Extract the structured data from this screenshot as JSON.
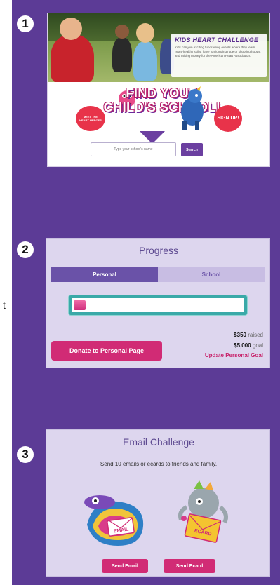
{
  "edge_text": "t",
  "steps": [
    "1",
    "2",
    "3"
  ],
  "panel1": {
    "card_title": "KIDS HEART CHALLENGE",
    "card_body": "Kids can join exciting fundraising events where they learn heart-healthy skills, have fun jumping rope or shooting hoops, and raising money for the American Heart Association.",
    "find_school_title": "FIND YOUR CHILD'S SCHOOL!",
    "bubble_left": "MEET THE HEART HEROES",
    "bubble_right": "SIGN UP!",
    "search_placeholder": "Type your school's name",
    "search_button": "Search"
  },
  "panel2": {
    "title": "Progress",
    "tab_personal": "Personal",
    "tab_school": "School",
    "progress_fraction": 0.07,
    "raised_amount": "$350",
    "raised_label": "raised",
    "goal_amount": "$5,000",
    "goal_label": "goal",
    "update_link": "Update Personal Goal",
    "donate_button": "Donate to Personal Page"
  },
  "panel3": {
    "title": "Email Challenge",
    "subtitle": "Send 10 emails or ecards to friends and family.",
    "email_art_label": "EMAIL",
    "ecard_art_label": "ECARD",
    "send_email_button": "Send Email",
    "send_ecard_button": "Send Ecard"
  },
  "colors": {
    "background_purple": "#5c3b96",
    "panel_lavender": "#ddd6ee",
    "accent_pink": "#d12b75",
    "tab_purple": "#6a52a8",
    "progress_teal": "#3aa9a8"
  }
}
